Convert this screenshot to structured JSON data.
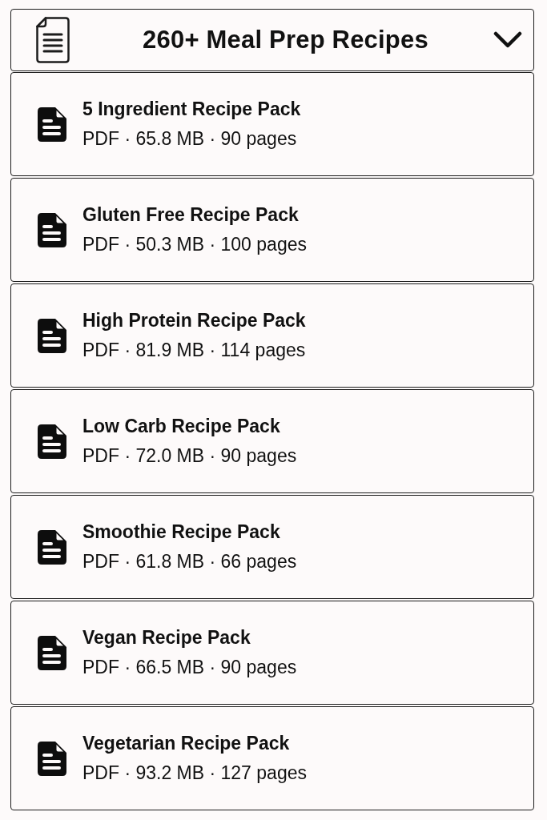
{
  "header": {
    "title": "260+ Meal Prep Recipes"
  },
  "files": [
    {
      "title": "5 Ingredient Recipe Pack",
      "meta": "PDF · 65.8 MB · 90 pages"
    },
    {
      "title": "Gluten Free Recipe Pack",
      "meta": "PDF · 50.3 MB · 100 pages"
    },
    {
      "title": "High Protein Recipe Pack",
      "meta": "PDF · 81.9 MB · 114 pages"
    },
    {
      "title": "Low Carb Recipe Pack",
      "meta": "PDF · 72.0 MB · 90 pages"
    },
    {
      "title": "Smoothie Recipe Pack",
      "meta": "PDF · 61.8 MB · 66 pages"
    },
    {
      "title": "Vegan Recipe Pack",
      "meta": "PDF · 66.5 MB · 90 pages"
    },
    {
      "title": "Vegetarian Recipe Pack",
      "meta": "PDF · 93.2 MB · 127 pages"
    }
  ]
}
